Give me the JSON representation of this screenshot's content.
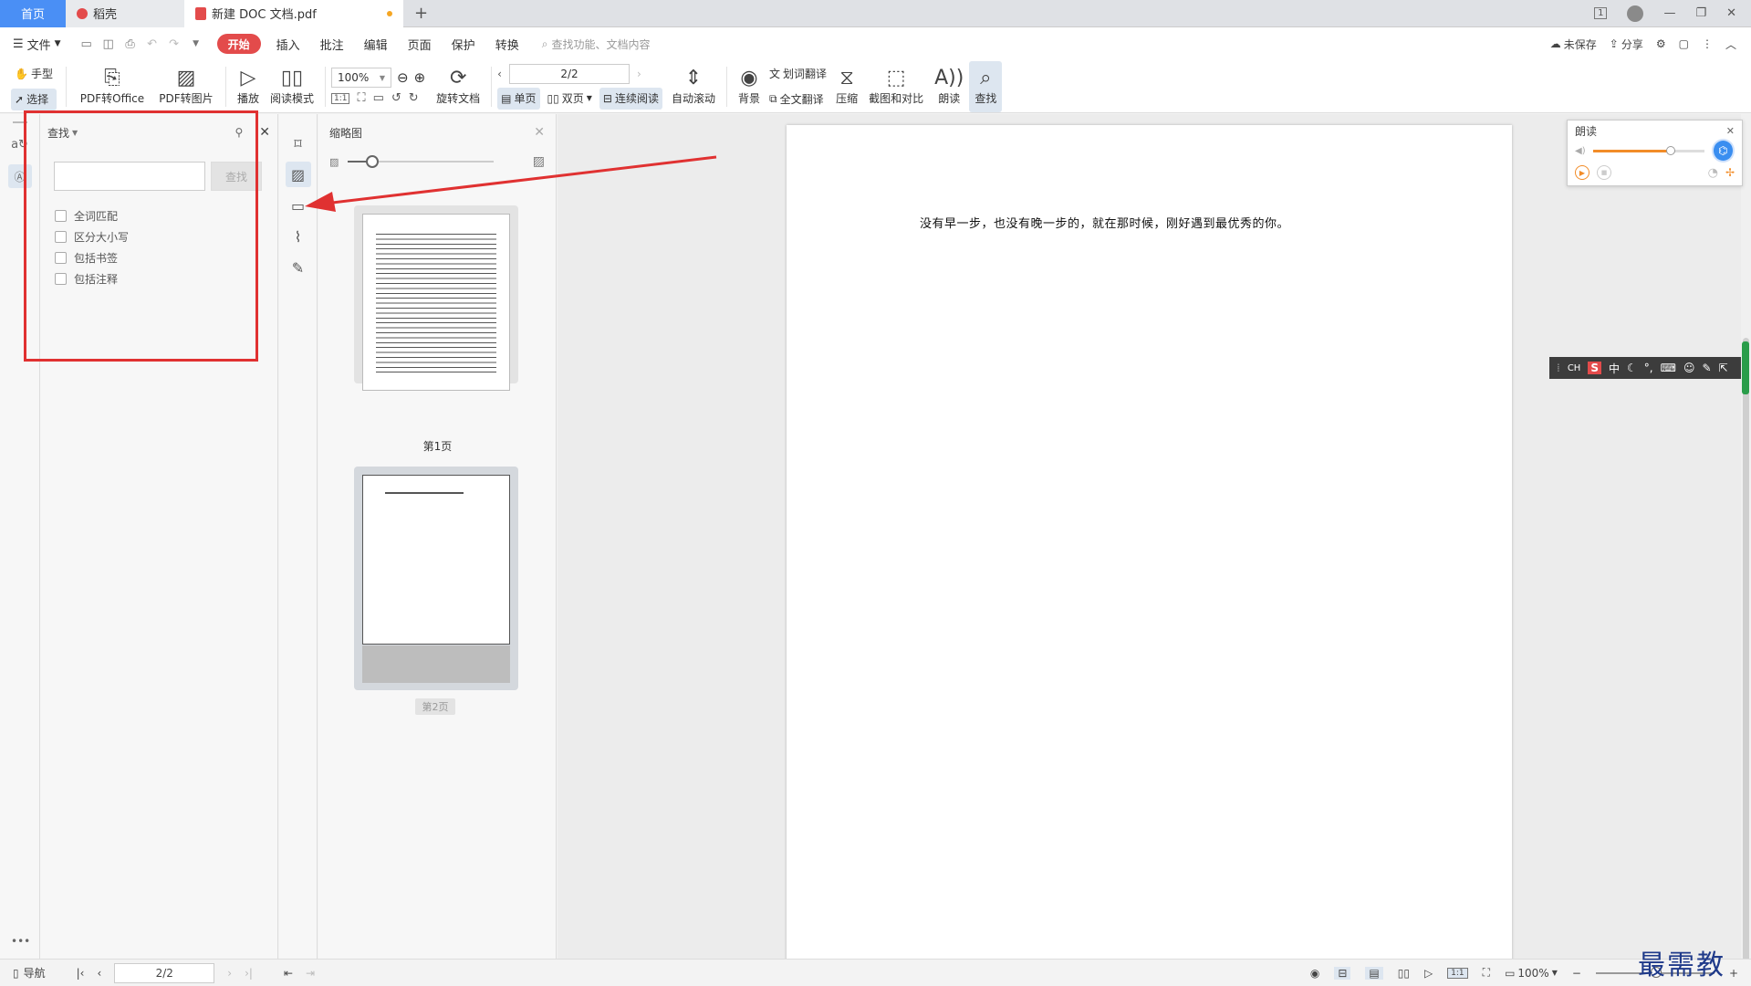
{
  "tabs": {
    "home": "首页",
    "shell": "稻壳",
    "doc": "新建 DOC 文档.pdf",
    "add": "+"
  },
  "titlebar": {
    "layout_icon": "1",
    "minimize": "—",
    "restore": "❐",
    "close": "✕"
  },
  "menu": {
    "file": "文件",
    "start": "开始",
    "items": [
      "插入",
      "批注",
      "编辑",
      "页面",
      "保护",
      "转换"
    ],
    "search_placeholder": "查找功能、文档内容",
    "unsaved": "未保存",
    "share": "分享"
  },
  "ribbon": {
    "hand": "手型",
    "select": "选择",
    "pdf_to_office": "PDF转Office",
    "pdf_to_image": "PDF转图片",
    "play": "播放",
    "read_mode": "阅读模式",
    "zoom": "100%",
    "rotate_doc": "旋转文档",
    "page_value": "2/2",
    "single": "单页",
    "double": "双页",
    "continuous": "连续阅读",
    "auto_scroll": "自动滚动",
    "background": "背景",
    "word_translate": "划词翻译",
    "full_translate": "全文翻译",
    "compress": "压缩",
    "screenshot_compare": "截图和对比",
    "read_aloud": "朗读",
    "find": "查找"
  },
  "find_panel": {
    "title": "查找",
    "input_value": "",
    "button": "查找",
    "options": [
      "全词匹配",
      "区分大小写",
      "包括书签",
      "包括注释"
    ]
  },
  "thumbnails": {
    "title": "缩略图",
    "pages": [
      "第1页",
      "第2页"
    ],
    "selected_page": 2
  },
  "document": {
    "text": "没有早一步，也没有晚一步的，就在那时候，刚好遇到最优秀的你。"
  },
  "read_widget": {
    "title": "朗读",
    "volume_level": 0.7
  },
  "ime": {
    "ch": "CH",
    "s": "S",
    "zh": "中"
  },
  "statusbar": {
    "nav": "导航",
    "page": "2/2",
    "zoom": "100%",
    "more": "•••"
  },
  "watermark": "最需教育",
  "colors": {
    "accent_blue": "#4a8ff5",
    "start_red": "#e34b4b",
    "annotation_red": "#e03131",
    "read_orange": "#f28c28"
  }
}
